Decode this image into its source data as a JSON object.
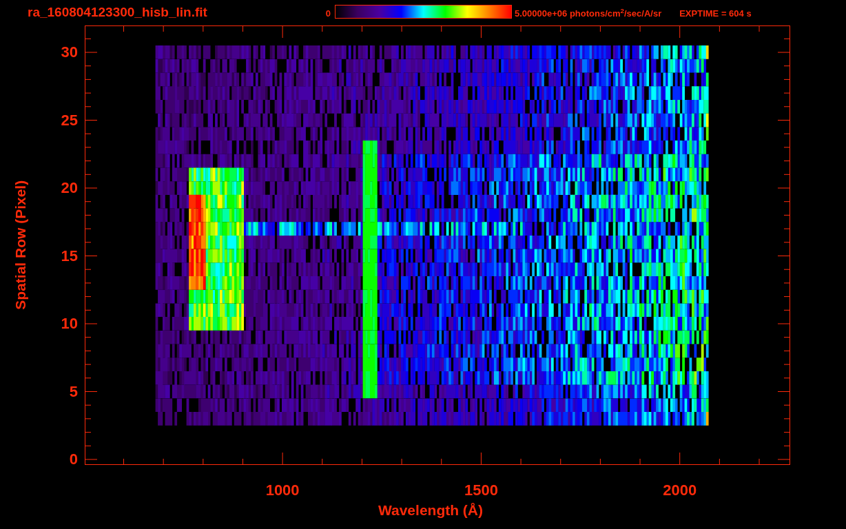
{
  "header": {
    "filename": "ra_160804123300_hisb_lin.fit",
    "colorbar_min": "0",
    "colorbar_max": "5.00000e+06 photons/cm$^{2}$/sec/A/sr",
    "exposure": "EXPTIME = 604 s"
  },
  "y_axis": {
    "label": "Spatial Row (Pixel)",
    "ticks": [
      "30",
      "25",
      "20",
      "15",
      "10",
      "5",
      "0"
    ]
  },
  "x_axis": {
    "label": "Wavelength (Å)",
    "ticks": [
      "1000",
      "1500",
      "2000"
    ]
  }
}
